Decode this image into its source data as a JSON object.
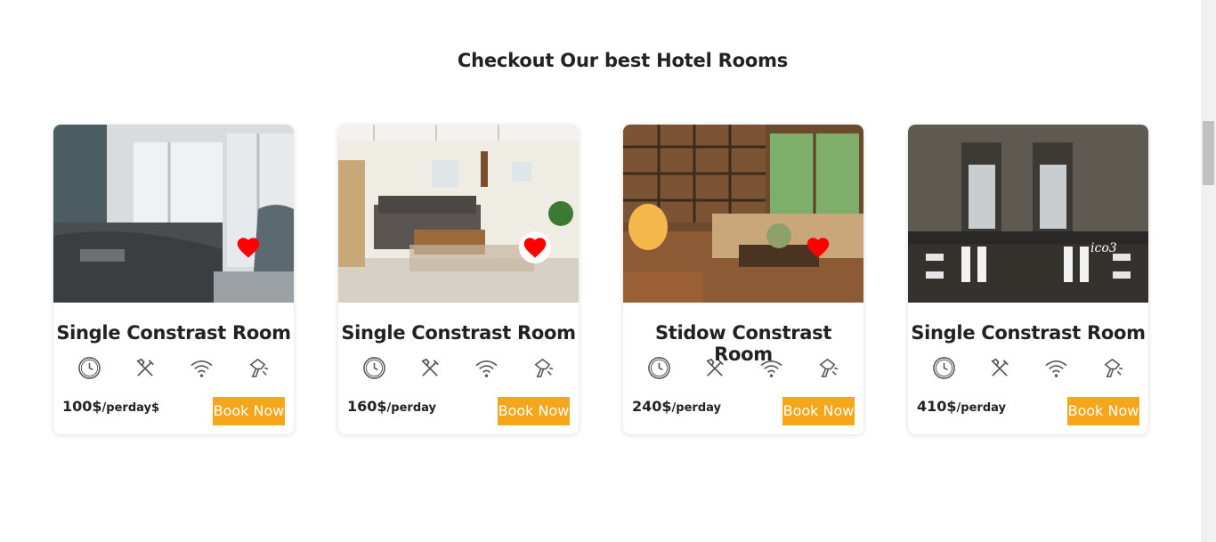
{
  "section": {
    "title": "Checkout Our best Hotel Rooms"
  },
  "rooms": [
    {
      "name": "Single Constrast Room",
      "price": "100$",
      "unit": "/perday$",
      "button": "Book Now",
      "favorite": "heart-icon"
    },
    {
      "name": "Single Constrast Room",
      "price": "160$",
      "unit": "/perday",
      "button": "Book Now",
      "favorite": "heart-icon"
    },
    {
      "name": "Stidow Constrast Room",
      "price": "240$",
      "unit": "/perday",
      "button": "Book Now",
      "favorite": "heart-icon"
    },
    {
      "name": "Single Constrast Room",
      "price": "410$",
      "unit": "/perday",
      "button": "Book Now",
      "favorite_alt_text": "ico3"
    }
  ],
  "amenity_icons": [
    "clock-icon",
    "tools-icon",
    "wifi-icon",
    "hair-dryer-icon"
  ],
  "colors": {
    "accent": "#f5a61b",
    "heart": "#ff0000",
    "text": "#222222"
  }
}
